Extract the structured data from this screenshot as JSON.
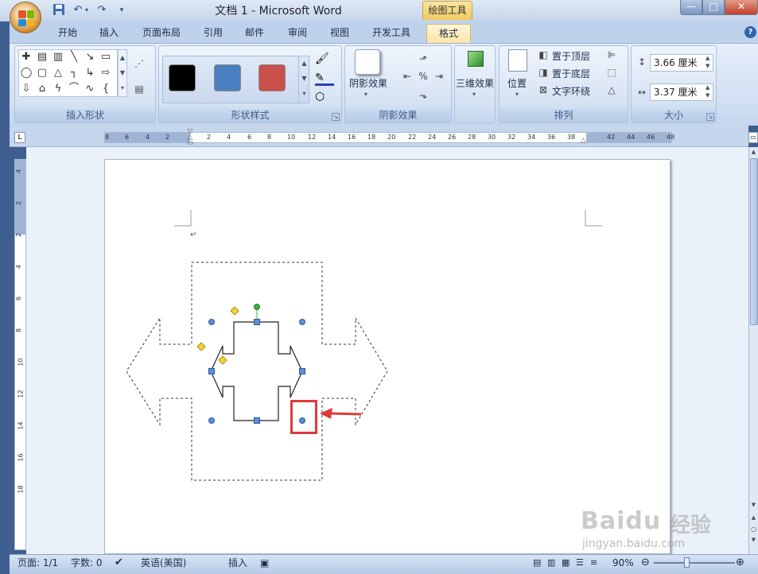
{
  "window": {
    "title": "文档 1 - Microsoft Word",
    "context_tab_title": "绘图工具",
    "buttons": {
      "minimize": "—",
      "maximize": "□",
      "close": "✕"
    }
  },
  "quick_access": {
    "save_icon": "save-icon",
    "undo_icon": "undo-icon",
    "redo_icon": "redo-icon",
    "customize_icon": "dropdown-icon"
  },
  "tabs": [
    "开始",
    "插入",
    "页面布局",
    "引用",
    "邮件",
    "审阅",
    "视图",
    "开发工具",
    "格式"
  ],
  "active_tab": "格式",
  "help_icon": "?",
  "ribbon": {
    "insert_shapes": {
      "label": "插入形状"
    },
    "shape_styles": {
      "label": "形状样式",
      "swatches": [
        "#000000",
        "#4a7fc0",
        "#c9504b"
      ]
    },
    "shadow_effects": {
      "label": "阴影效果",
      "button": "阴影效果"
    },
    "effects_3d": {
      "button": "三维效果"
    },
    "arrange": {
      "label": "排列",
      "position": "位置",
      "bring_front": "置于顶层",
      "send_back": "置于底层",
      "text_wrap": "文字环绕"
    },
    "size": {
      "label": "大小",
      "height": "3.66 厘米",
      "width": "3.37 厘米"
    }
  },
  "ruler": {
    "horizontal_ticks": [
      "8",
      "6",
      "4",
      "2",
      "2",
      "4",
      "6",
      "8",
      "10",
      "12",
      "14",
      "16",
      "18",
      "20",
      "22",
      "24",
      "26",
      "28",
      "30",
      "32",
      "34",
      "36",
      "38",
      "42",
      "44",
      "46",
      "48"
    ],
    "vertical_ticks": [
      "4",
      "2",
      "2",
      "4",
      "6",
      "8",
      "10",
      "12",
      "14",
      "16",
      "18"
    ]
  },
  "document": {
    "paragraph_mark": "↵"
  },
  "status": {
    "page": "页面: 1/1",
    "words": "字数: 0",
    "language": "英语(美国)",
    "mode": "插入",
    "zoom": "90%"
  },
  "colors": {
    "accent": "#c9504b",
    "handle": "#5b8fd6",
    "rotate_handle": "#3cb043",
    "adjust_handle": "#f2d53c",
    "highlight": "#e03a3a"
  },
  "watermark": {
    "brand": "Baidu",
    "brand_cn": "经验",
    "url": "jingyan.baidu.com"
  }
}
